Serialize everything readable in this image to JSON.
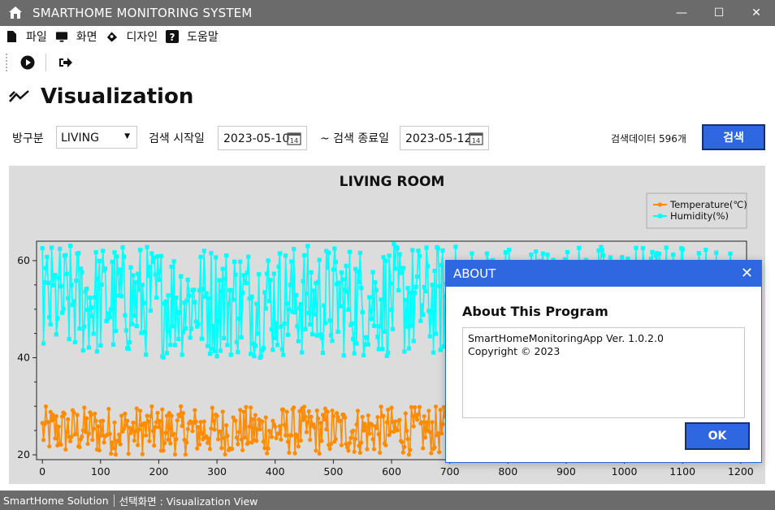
{
  "window": {
    "title": "SMARTHOME MONITORING SYSTEM"
  },
  "menu": [
    {
      "label": "파일",
      "icon": "file-icon"
    },
    {
      "label": "화면",
      "icon": "monitor-icon"
    },
    {
      "label": "디자인",
      "icon": "design-icon"
    },
    {
      "label": "도움말",
      "icon": "help-icon"
    }
  ],
  "toolbar": {
    "items": [
      {
        "icon": "play-icon"
      },
      {
        "icon": "exit-icon"
      }
    ]
  },
  "page": {
    "title": "Visualization"
  },
  "filter": {
    "room_label": "방구분",
    "room_value": "LIVING",
    "start_label": "검색 시작일",
    "start_date": "2023-05-10",
    "end_label": "~ 검색 종료일",
    "end_date": "2023-05-12",
    "count_text": "검색데이터 596개",
    "search_label": "검색"
  },
  "chart_data": {
    "type": "line",
    "title": "LIVING ROOM",
    "xlim": [
      -10,
      1210
    ],
    "ylim": [
      19,
      64
    ],
    "x_ticks": [
      0,
      100,
      200,
      300,
      400,
      500,
      600,
      700,
      800,
      900,
      1000,
      1100,
      1200
    ],
    "y_ticks": [
      20,
      40,
      60
    ],
    "grid": false,
    "legend_position": "top-right",
    "series": [
      {
        "name": "Temperature(℃)",
        "color": "#ff8c00",
        "x_start": 0,
        "x_step": 2,
        "count": 596,
        "min": 20,
        "max": 30,
        "style": "noisy oscillation"
      },
      {
        "name": "Humidity(%)",
        "color": "#00ffff",
        "x_start": 0,
        "x_step": 2,
        "count": 596,
        "min": 40,
        "max": 63.5,
        "style": "noisy oscillation"
      }
    ]
  },
  "status": {
    "left": "SmartHome Solution",
    "right": "선택화면 : Visualization View"
  },
  "about_dialog": {
    "title": "ABOUT",
    "heading": "About This Program",
    "lines": [
      "SmartHomeMonitoringApp Ver. 1.0.2.0",
      "Copyright ©  2023"
    ],
    "ok_label": "OK"
  },
  "colors": {
    "accent": "#2f67e0",
    "titlebar": "#6b6b6b",
    "chart_bg": "#dcdcdc"
  }
}
